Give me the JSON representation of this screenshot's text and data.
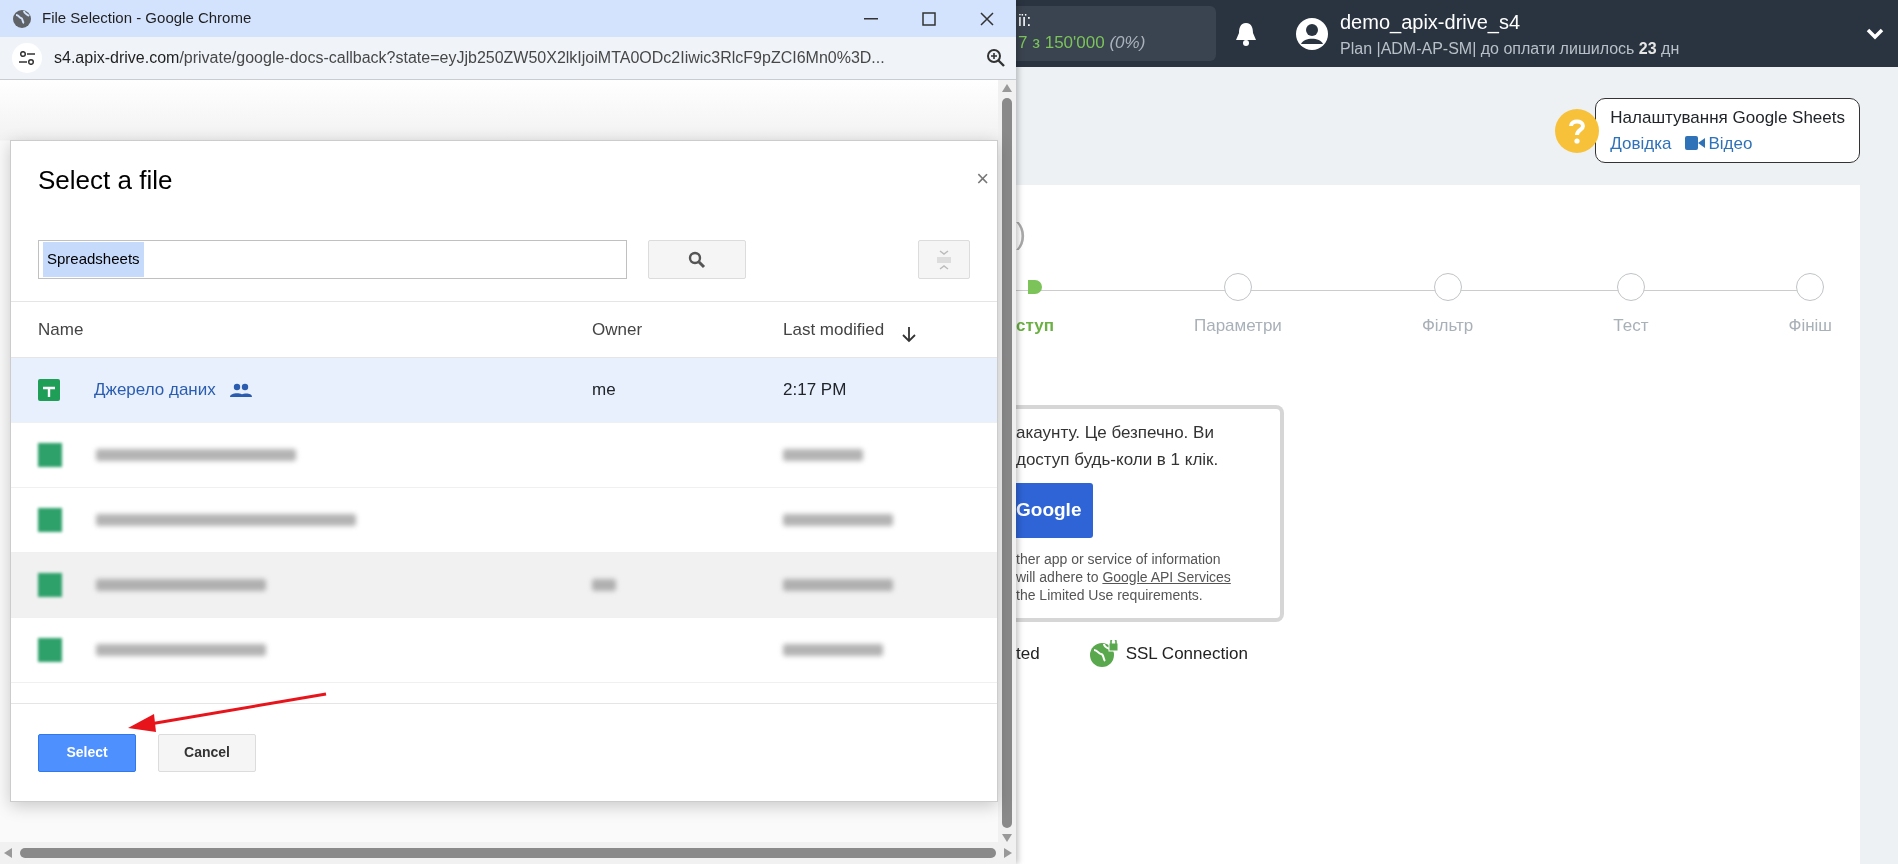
{
  "browser_window": {
    "title": "File Selection - Google Chrome",
    "url_host": "s4.apix-drive.com",
    "url_path": "/private/google-docs-callback?state=eyJjb250ZW50X2lkIjoiMTA0ODc2Iiwic3RlcF9pZCI6Mn0%3D..."
  },
  "picker": {
    "title": "Select a file",
    "close_label": "×",
    "search": {
      "value": "Spreadsheets"
    },
    "columns": [
      {
        "label": "Name",
        "sorted": false
      },
      {
        "label": "Owner",
        "sorted": false
      },
      {
        "label": "Last modified",
        "sorted": true
      }
    ],
    "rows": [
      {
        "kind": "file",
        "name": "Джерело даних",
        "shared": true,
        "owner": "me",
        "modified": "2:17 PM",
        "selected": true,
        "hovered": false
      },
      {
        "kind": "blurred",
        "owner_visible": false,
        "selected": false,
        "hovered": false
      },
      {
        "kind": "blurred",
        "owner_visible": false,
        "selected": false,
        "hovered": false
      },
      {
        "kind": "blurred",
        "owner_visible": true,
        "selected": false,
        "hovered": true
      },
      {
        "kind": "blurred",
        "owner_visible": false,
        "selected": false,
        "hovered": false
      }
    ],
    "buttons": [
      {
        "label": "Select",
        "kind": "primary"
      },
      {
        "label": "Cancel",
        "kind": "secondary"
      }
    ]
  },
  "annotations": [
    {
      "kind": "arrow"
    }
  ],
  "header": {
    "actions_label": "ії:",
    "actions_count": "7 з 150'000",
    "actions_percent": "(0%)",
    "user": "demo_apix-drive_s4",
    "plan": "Plan |ADM-AP-SM| до оплати лишилось **23** дн"
  },
  "help": {
    "title": "Налаштування Google Sheets",
    "links": [
      "Довідка",
      "Відео"
    ]
  },
  "page": {
    "title_fragment": ")",
    "steps": [
      {
        "label": "ступ",
        "active": true
      },
      {
        "label": "Параметри",
        "active": false
      },
      {
        "label": "Фільтр",
        "active": false
      },
      {
        "label": "Тест",
        "active": false
      },
      {
        "label": "Фініш",
        "active": false
      }
    ],
    "auth": {
      "lines": [
        "акаунту. Це безпечно. Ви",
        "доступ будь-коли в 1 клік."
      ],
      "button": "Google",
      "notice": {
        "line_1": "ther app or service of information",
        "line_2": "will adhere to",
        "link": "Google API Services",
        "line_3": "the Limited Use requirements."
      }
    },
    "features": [
      {
        "label": "ted",
        "kind": "plain"
      },
      {
        "label": "SSL Connection",
        "kind": "secure"
      }
    ]
  }
}
